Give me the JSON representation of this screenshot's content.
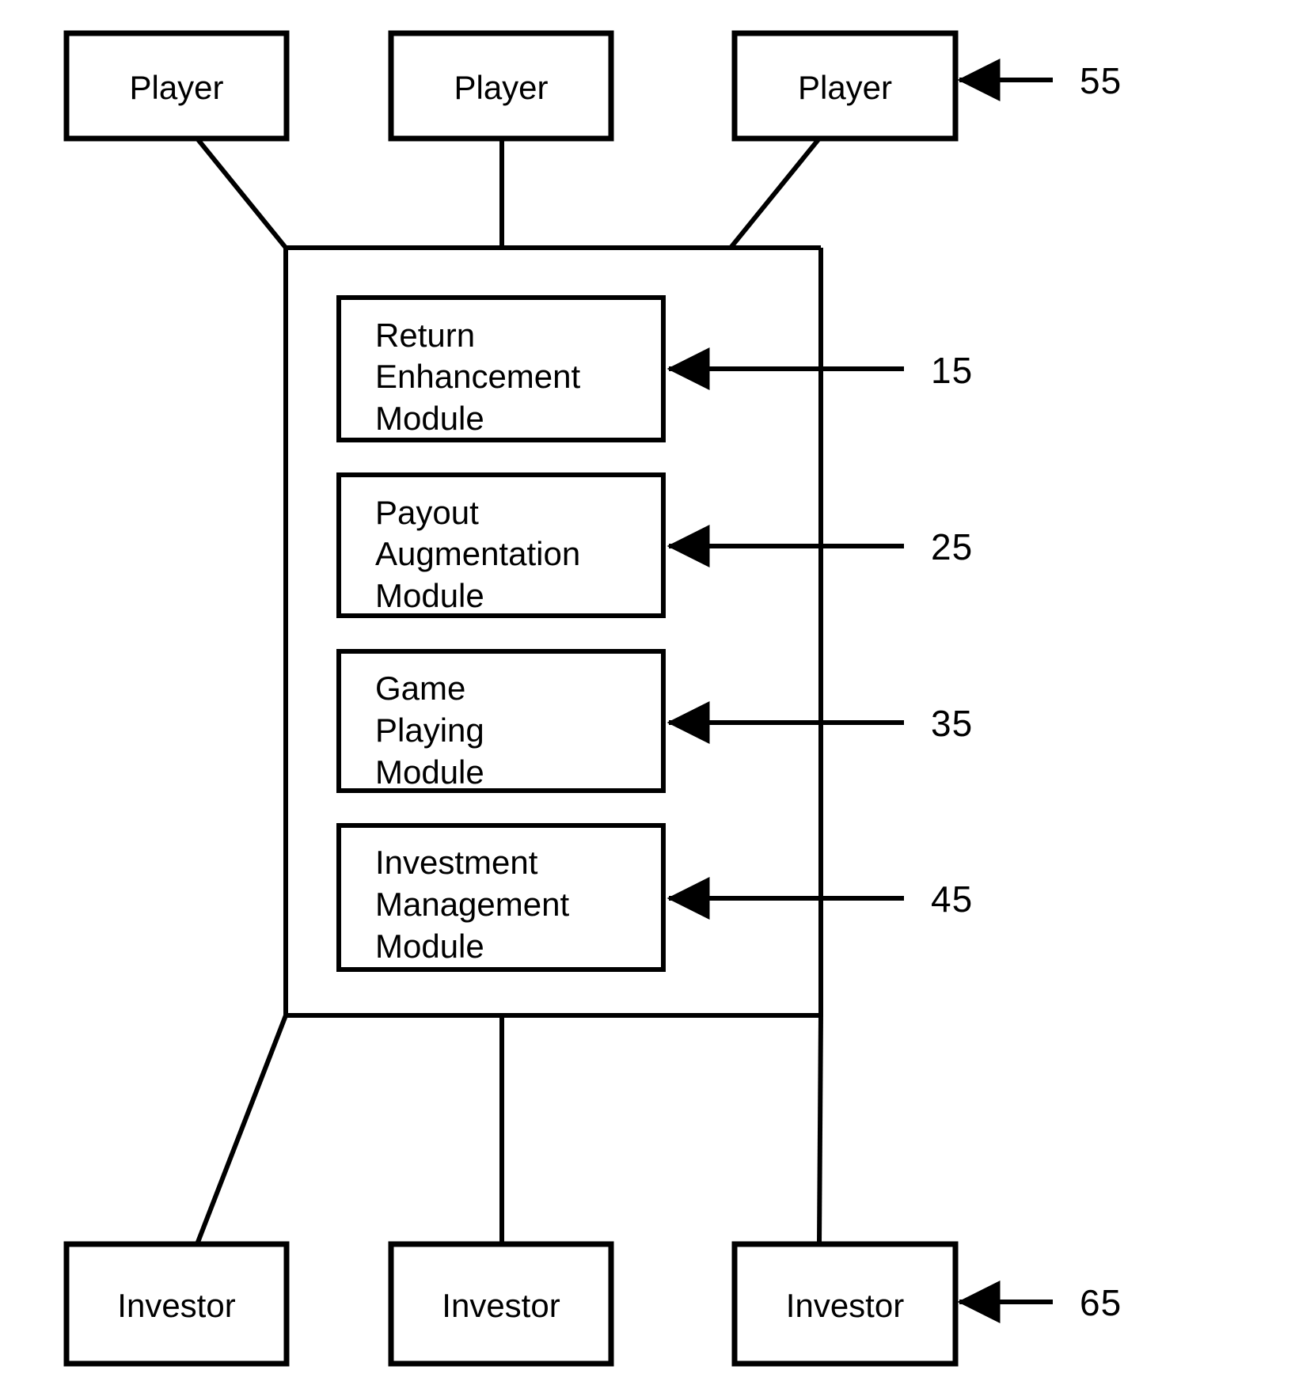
{
  "figure": {
    "type": "patent-block-diagram",
    "background_color": "#ffffff",
    "line_color": "#000000"
  },
  "top_nodes": [
    {
      "id": "player-1",
      "label": "Player"
    },
    {
      "id": "player-2",
      "label": "Player"
    },
    {
      "id": "player-3",
      "label": "Player"
    }
  ],
  "bottom_nodes": [
    {
      "id": "investor-1",
      "label": "Investor"
    },
    {
      "id": "investor-2",
      "label": "Investor"
    },
    {
      "id": "investor-3",
      "label": "Investor"
    }
  ],
  "modules": [
    {
      "id": "module-return-enhancement",
      "line1": "Return",
      "line2": "Enhancement",
      "line3": "Module",
      "ref": "15"
    },
    {
      "id": "module-payout-augmentation",
      "line1": "Payout",
      "line2": "Augmentation",
      "line3": "Module",
      "ref": "25"
    },
    {
      "id": "module-game-playing",
      "line1": "Game",
      "line2": "Playing",
      "line3": "Module",
      "ref": "35"
    },
    {
      "id": "module-investment-management",
      "line1": "Investment",
      "line2": "Management",
      "line3": "Module",
      "ref": "45"
    }
  ],
  "reference_numerals": {
    "players": "55",
    "module_1": "15",
    "module_2": "25",
    "module_3": "35",
    "module_4": "45",
    "investors": "65"
  }
}
